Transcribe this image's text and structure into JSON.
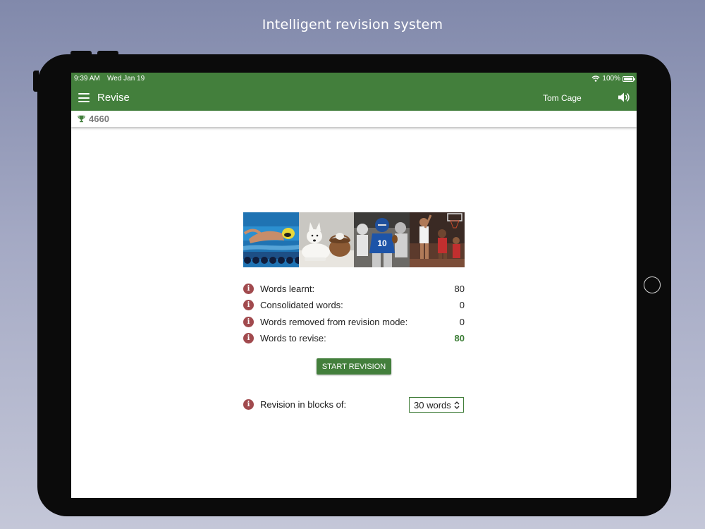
{
  "headline": "Intelligent revision system",
  "status_bar": {
    "time": "9:39 AM",
    "date": "Wed Jan 19",
    "battery": "100%"
  },
  "app_bar": {
    "title": "Revise",
    "user_name": "Tom Cage",
    "icons": [
      "menu-icon",
      "speaker-icon"
    ]
  },
  "score": {
    "icon": "trophy-icon",
    "value": "4660"
  },
  "banner": {
    "images": [
      "swimmer-photo",
      "dog-and-cat-photo",
      "american-football-photo",
      "basketball-photo"
    ]
  },
  "stats": [
    {
      "label": "Words learnt:",
      "value": "80"
    },
    {
      "label": "Consolidated words:",
      "value": "0"
    },
    {
      "label": "Words removed from revision mode:",
      "value": "0"
    },
    {
      "label": "Words to revise:",
      "value": "80"
    }
  ],
  "start_button_label": "START REVISION",
  "blocks": {
    "label": "Revision in blocks of:",
    "selected": "30 words"
  },
  "colors": {
    "primary_green": "#437f3c",
    "info_icon": "#a14a4e",
    "highlight_value": "#3c7d36"
  }
}
